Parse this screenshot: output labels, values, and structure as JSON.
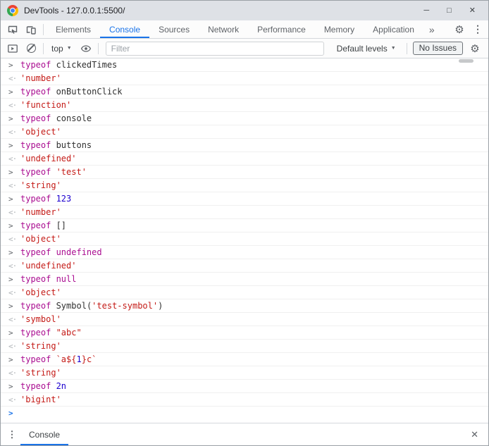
{
  "colors": {
    "accent": "#1a73e8",
    "titlebar-bg": "#dee1e6",
    "token-keyword": "#aa0d91",
    "token-string": "#c41a16",
    "token-number": "#1c00cf",
    "token-ident": "#303030"
  },
  "icons": {
    "gear": "⚙",
    "kebab": "⋮",
    "more_tabs": "»",
    "caret": "▼"
  },
  "titlebar": {
    "title": "DevTools - 127.0.0.1:5500/",
    "minimize": "─",
    "maximize": "□",
    "close": "✕"
  },
  "tabbar": {
    "tabs": [
      {
        "label": "Elements"
      },
      {
        "label": "Console"
      },
      {
        "label": "Sources"
      },
      {
        "label": "Network"
      },
      {
        "label": "Performance"
      },
      {
        "label": "Memory"
      },
      {
        "label": "Application"
      }
    ],
    "active": "Console"
  },
  "toolbar": {
    "context": "top",
    "filter_placeholder": "Filter",
    "levels": "Default levels",
    "issues": "No Issues"
  },
  "console": {
    "input_marker": ">",
    "result_marker": "<·",
    "prompt_marker": ">",
    "entries": [
      {
        "kind": "input",
        "tokens": [
          [
            "k",
            "typeof "
          ],
          [
            "i",
            "clickedTimes"
          ]
        ]
      },
      {
        "kind": "result",
        "tokens": [
          [
            "s",
            "'number'"
          ]
        ]
      },
      {
        "kind": "input",
        "tokens": [
          [
            "k",
            "typeof "
          ],
          [
            "i",
            "onButtonClick"
          ]
        ]
      },
      {
        "kind": "result",
        "tokens": [
          [
            "s",
            "'function'"
          ]
        ]
      },
      {
        "kind": "input",
        "tokens": [
          [
            "k",
            "typeof "
          ],
          [
            "i",
            "console"
          ]
        ]
      },
      {
        "kind": "result",
        "tokens": [
          [
            "s",
            "'object'"
          ]
        ]
      },
      {
        "kind": "input",
        "tokens": [
          [
            "k",
            "typeof "
          ],
          [
            "i",
            "buttons"
          ]
        ]
      },
      {
        "kind": "result",
        "tokens": [
          [
            "s",
            "'undefined'"
          ]
        ]
      },
      {
        "kind": "input",
        "tokens": [
          [
            "k",
            "typeof "
          ],
          [
            "s",
            "'test'"
          ]
        ]
      },
      {
        "kind": "result",
        "tokens": [
          [
            "s",
            "'string'"
          ]
        ]
      },
      {
        "kind": "input",
        "tokens": [
          [
            "k",
            "typeof "
          ],
          [
            "n",
            "123"
          ]
        ]
      },
      {
        "kind": "result",
        "tokens": [
          [
            "s",
            "'number'"
          ]
        ]
      },
      {
        "kind": "input",
        "tokens": [
          [
            "k",
            "typeof "
          ],
          [
            "p",
            "[]"
          ]
        ]
      },
      {
        "kind": "result",
        "tokens": [
          [
            "s",
            "'object'"
          ]
        ]
      },
      {
        "kind": "input",
        "tokens": [
          [
            "k",
            "typeof "
          ],
          [
            "k",
            "undefined"
          ]
        ]
      },
      {
        "kind": "result",
        "tokens": [
          [
            "s",
            "'undefined'"
          ]
        ]
      },
      {
        "kind": "input",
        "tokens": [
          [
            "k",
            "typeof "
          ],
          [
            "k",
            "null"
          ]
        ]
      },
      {
        "kind": "result",
        "tokens": [
          [
            "s",
            "'object'"
          ]
        ]
      },
      {
        "kind": "input",
        "tokens": [
          [
            "k",
            "typeof "
          ],
          [
            "i",
            "Symbol"
          ],
          [
            "p",
            "("
          ],
          [
            "s",
            "'test-symbol'"
          ],
          [
            "p",
            ")"
          ]
        ]
      },
      {
        "kind": "result",
        "tokens": [
          [
            "s",
            "'symbol'"
          ]
        ]
      },
      {
        "kind": "input",
        "tokens": [
          [
            "k",
            "typeof "
          ],
          [
            "s",
            "\"abc\""
          ]
        ]
      },
      {
        "kind": "result",
        "tokens": [
          [
            "s",
            "'string'"
          ]
        ]
      },
      {
        "kind": "input",
        "tokens": [
          [
            "k",
            "typeof "
          ],
          [
            "s",
            "`a${"
          ],
          [
            "n",
            "1"
          ],
          [
            "s",
            "}c`"
          ]
        ]
      },
      {
        "kind": "result",
        "tokens": [
          [
            "s",
            "'string'"
          ]
        ]
      },
      {
        "kind": "input",
        "tokens": [
          [
            "k",
            "typeof "
          ],
          [
            "n",
            "2n"
          ]
        ]
      },
      {
        "kind": "result",
        "tokens": [
          [
            "s",
            "'bigint'"
          ]
        ]
      }
    ]
  },
  "footer": {
    "tab": "Console",
    "close": "✕"
  }
}
